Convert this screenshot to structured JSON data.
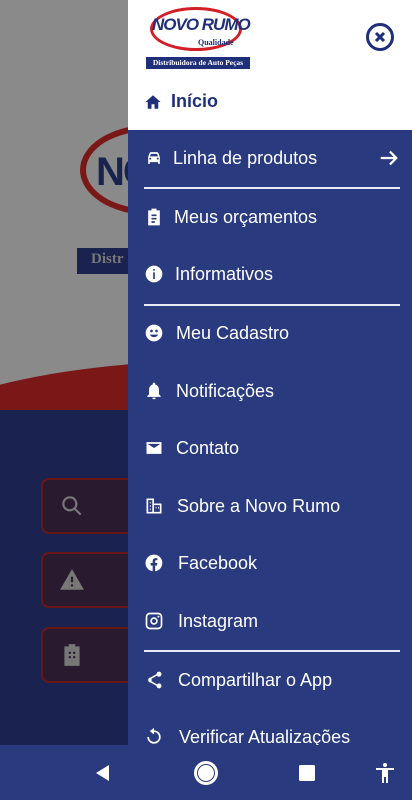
{
  "background": {
    "logo_text": "NO",
    "strip_text": "Distr"
  },
  "drawer": {
    "logo": {
      "main": "NOVO RUMO",
      "sub": "Qualidade",
      "strip": "Distribuidora de Auto Peças"
    },
    "home_label": "Início",
    "items": [
      {
        "label": "Linha de produtos",
        "icon": "car-icon"
      },
      {
        "label": "Meus orçamentos",
        "icon": "clipboard-icon"
      },
      {
        "label": "Informativos",
        "icon": "info-icon"
      },
      {
        "label": "Meu Cadastro",
        "icon": "user-face-icon"
      },
      {
        "label": "Notificações",
        "icon": "bell-icon"
      },
      {
        "label": "Contato",
        "icon": "envelope-icon"
      },
      {
        "label": "Sobre a Novo Rumo",
        "icon": "buildings-icon"
      },
      {
        "label": "Facebook",
        "icon": "facebook-icon"
      },
      {
        "label": "Instagram",
        "icon": "instagram-icon"
      },
      {
        "label": "Compartilhar o App",
        "icon": "share-icon"
      },
      {
        "label": "Verificar Atualizações",
        "icon": "refresh-icon"
      }
    ]
  },
  "colors": {
    "drawer_bg": "#293a7e",
    "brand_blue": "#1f2f7a",
    "brand_red": "#d21f26"
  }
}
